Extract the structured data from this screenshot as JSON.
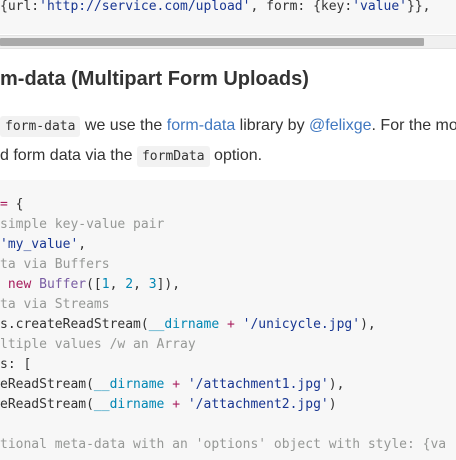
{
  "top_code": {
    "line_pre": "{url:",
    "url_str": "'http://service.com/upload'",
    "mid": ", form: {key:",
    "val_str": "'value'",
    "tail": "}},"
  },
  "heading": "m-data (Multipart Form Uploads)",
  "paragraph": {
    "line1_code": "form-data",
    "line1_a": "we use the",
    "line1_link1": "form-data",
    "line1_b": "library by",
    "line1_link2": "@felixge",
    "line1_c": ". For the mos",
    "line2_a": "d form data via the",
    "line2_code": "formData",
    "line2_b": "option."
  },
  "code": {
    "l1_op": "=",
    "l1_brace": " {",
    "l2_cm": "simple key-value pair",
    "l3_str": "'my_value'",
    "l3_tail": ",",
    "l4_cm": "ta via Buffers",
    "l5_kw": "new",
    "l5_fn": "Buffer",
    "l5_a": "([",
    "l5_n1": "1",
    "l5_sep1": ", ",
    "l5_n2": "2",
    "l5_sep2": ", ",
    "l5_n3": "3",
    "l5_b": "]),",
    "l6_cm": "ta via Streams",
    "l7_a": "s.createReadStream(",
    "l7_bi": "__dirname",
    "l7_op": " + ",
    "l7_str": "'/unicycle.jpg'",
    "l7_b": "),",
    "l8_cm": "ltiple values /w an Array",
    "l9_a": "s: [",
    "l10_a": "eReadStream(",
    "l10_bi": "__dirname",
    "l10_op": " + ",
    "l10_str": "'/attachment1.jpg'",
    "l10_b": "),",
    "l11_a": "eReadStream(",
    "l11_bi": "__dirname",
    "l11_op": " + ",
    "l11_str": "'/attachment2.jpg'",
    "l11_b": ")",
    "l13_cm": "tional meta-data with an 'options' object with style: {va"
  }
}
